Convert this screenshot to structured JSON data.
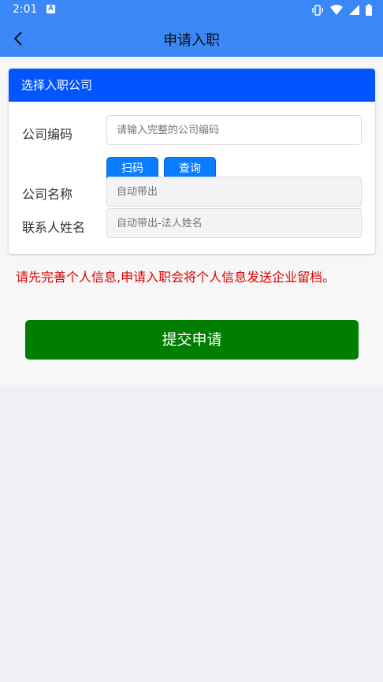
{
  "status_bar": {
    "time": "2:01",
    "notification_letter": "A",
    "icons": [
      "vibrate-icon",
      "wifi-icon",
      "signal-icon",
      "battery-icon"
    ]
  },
  "nav": {
    "title": "申请入职",
    "back_icon": "back-arrow-icon"
  },
  "card": {
    "title": "选择入职公司",
    "company_code": {
      "label": "公司编码",
      "value": "",
      "placeholder": "请输入完整的公司编码"
    },
    "scan_button": "扫码",
    "query_button": "查询",
    "company_name": {
      "label": "公司名称",
      "value": "",
      "placeholder": "自动带出"
    },
    "contact_name": {
      "label": "联系人姓名",
      "value": "",
      "placeholder": "自动带出-法人姓名"
    }
  },
  "notice": "请先完善个人信息,申请入职会将个人信息发送企业留档。",
  "submit_button": "提交申请",
  "colors": {
    "header_bg": "#3a87f7",
    "card_header_bg": "#0055ff",
    "small_button_bg": "#0a7cff",
    "notice_text": "#e00000",
    "submit_bg": "#007e00"
  }
}
